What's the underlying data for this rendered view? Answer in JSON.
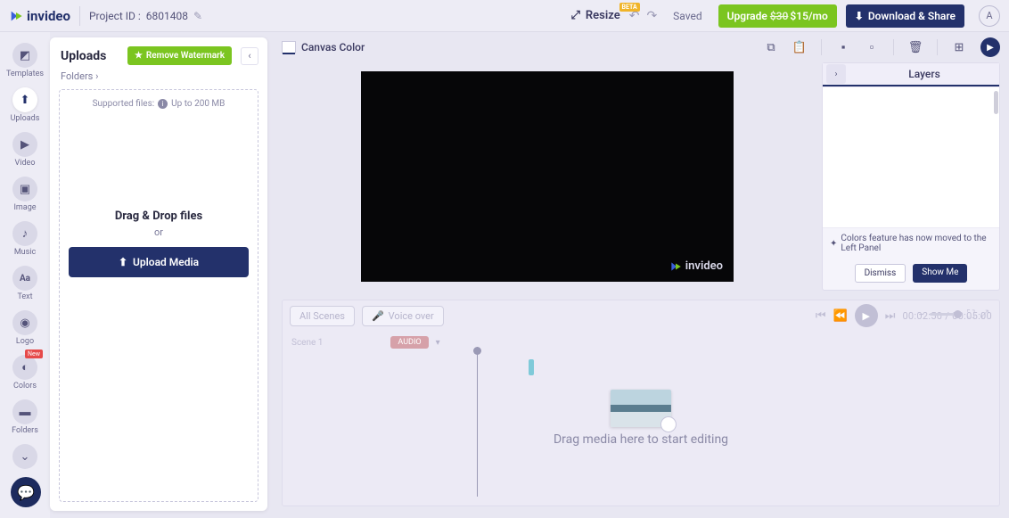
{
  "brand": "invideo",
  "project": {
    "label": "Project ID :",
    "id": "6801408"
  },
  "topbar": {
    "resize_label": "Resize",
    "resize_badge": "BETA",
    "saved": "Saved",
    "upgrade_prefix": "Upgrade",
    "upgrade_strike": "$30",
    "upgrade_price": "$15/mo",
    "download": "Download & Share",
    "avatar_initial": "A"
  },
  "rail": {
    "items": [
      {
        "label": "Templates"
      },
      {
        "label": "Uploads"
      },
      {
        "label": "Video"
      },
      {
        "label": "Image"
      },
      {
        "label": "Music"
      },
      {
        "label": "Text"
      },
      {
        "label": "Logo"
      },
      {
        "label": "Colors",
        "badge": "New"
      },
      {
        "label": "Folders"
      }
    ]
  },
  "uploads": {
    "title": "Uploads",
    "remove_wm": "Remove Watermark",
    "folders": "Folders ›",
    "supported_label": "Supported files:",
    "supported_hint": "Up to 200 MB",
    "dz_title": "Drag & Drop files",
    "dz_or": "or",
    "upload_btn": "Upload Media"
  },
  "canvas": {
    "canvas_color": "Canvas Color",
    "watermark": "invideo"
  },
  "layers": {
    "title": "Layers",
    "hint": "Colors feature has now moved to the Left Panel",
    "dismiss": "Dismiss",
    "show_me": "Show Me"
  },
  "timeline": {
    "all_scenes": "All Scenes",
    "voice_over": "Voice over",
    "scene_label": "Scene 1",
    "chip": "AUDIO",
    "time_current": "00:02:50",
    "time_total": "00:05:00",
    "dz_hint": "Drag media here to start editing"
  }
}
